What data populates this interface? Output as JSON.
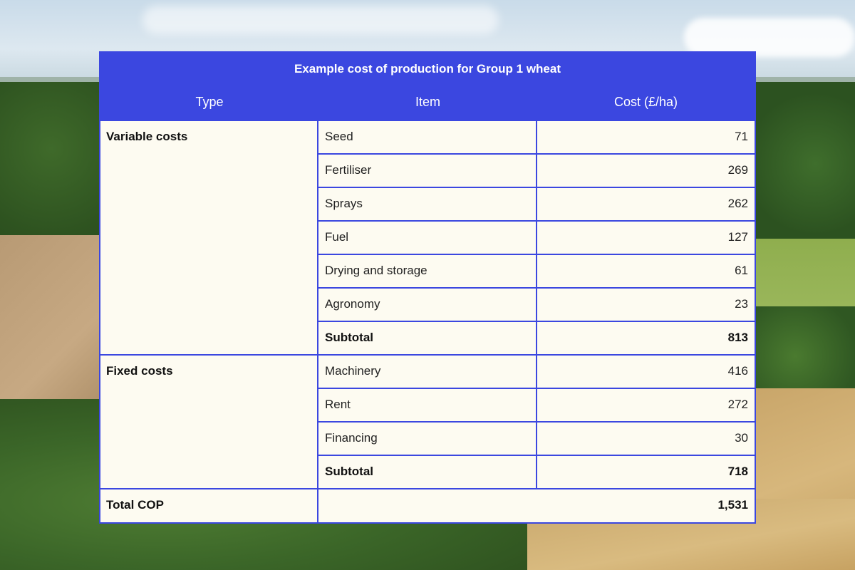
{
  "table": {
    "title": "Example cost of production for Group 1 wheat",
    "headers": {
      "type": "Type",
      "item": "Item",
      "cost": "Cost (£/ha)"
    },
    "variable": {
      "type": "Variable costs",
      "rows": [
        {
          "item": "Seed",
          "cost": "71"
        },
        {
          "item": "Fertiliser",
          "cost": "269"
        },
        {
          "item": "Sprays",
          "cost": "262"
        },
        {
          "item": "Fuel",
          "cost": "127"
        },
        {
          "item": "Drying and storage",
          "cost": "61"
        },
        {
          "item": "Agronomy",
          "cost": "23"
        }
      ],
      "subtotal": {
        "item": "Subtotal",
        "cost": "813"
      }
    },
    "fixed": {
      "type": "Fixed costs",
      "rows": [
        {
          "item": "Machinery",
          "cost": "416"
        },
        {
          "item": "Rent",
          "cost": "272"
        },
        {
          "item": "Financing",
          "cost": "30"
        }
      ],
      "subtotal": {
        "item": "Subtotal",
        "cost": "718"
      }
    },
    "total": {
      "type": "Total COP",
      "cost": "1,531"
    }
  },
  "colors": {
    "accent": "#3b47e0",
    "panel": "#fdfbf1"
  }
}
